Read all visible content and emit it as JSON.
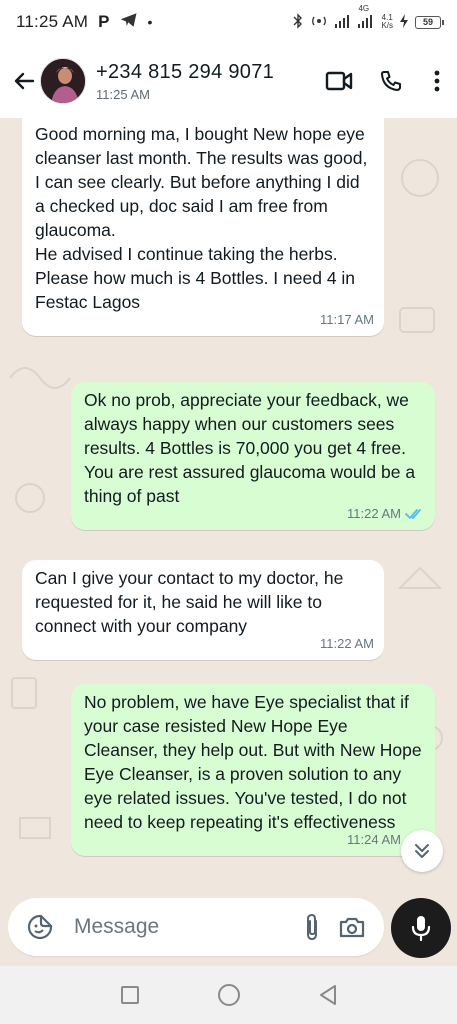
{
  "status_bar": {
    "time": "11:25 AM",
    "network_label": "4G",
    "speed_value": "4.1",
    "speed_unit": "K/s",
    "battery": "59"
  },
  "header": {
    "contact_name": "+234 815 294 9071",
    "last_seen": "11:25 AM"
  },
  "messages": [
    {
      "direction": "in",
      "text": "Good morning ma, I bought New hope eye cleanser last month. The results was good, I can see clearly. But before anything I did a checked up, doc said I am free from glaucoma.\nHe advised I continue taking the herbs.  Please how much is 4 Bottles. I need 4 in Festac Lagos",
      "time": "11:17 AM"
    },
    {
      "direction": "out",
      "text": "Ok no prob, appreciate your feedback, we always happy when our customers sees results. 4 Bottles is 70,000 you get 4 free. You are rest assured glaucoma would be a thing of past",
      "time": "11:22 AM",
      "status": "read"
    },
    {
      "direction": "in",
      "text": "Can I give your contact to my doctor, he requested for it, he said he will like to connect with your company",
      "time": "11:22 AM"
    },
    {
      "direction": "out",
      "text": "No problem, we have Eye specialist that if your case resisted New Hope Eye Cleanser, they help out. But with New Hope Eye Cleanser, is a proven solution to any eye related issues. You've tested, I do not need to keep repeating it's effectiveness",
      "time": "11:24 AM",
      "status": "read"
    }
  ],
  "composer": {
    "placeholder": "Message"
  },
  "colors": {
    "outgoing_bubble": "#d9fdd3",
    "incoming_bubble": "#ffffff",
    "wallpaper": "#efe7de",
    "read_ticks": "#53bdeb",
    "mic_button": "#1c1c1c"
  },
  "icons": {
    "back": "arrow-left-icon",
    "video": "video-call-icon",
    "call": "phone-icon",
    "menu": "more-vert-icon",
    "emoji": "sticker-icon",
    "attach": "paperclip-icon",
    "camera": "camera-icon",
    "mic": "mic-icon",
    "scroll": "double-chevron-down-icon"
  }
}
